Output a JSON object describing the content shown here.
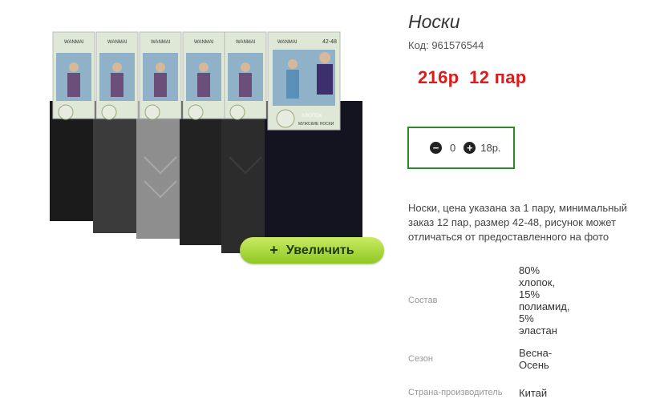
{
  "product": {
    "title": "Носки",
    "code": "Код: 961576544",
    "price_text": "216р  12 пар",
    "zoom_label": "Увеличить",
    "zoom_plus": "+",
    "description": "Носки, цена указана за 1 пару, минимальный заказ 12 пар, размер 42-48, рисунок может отличаться от предоставленного на фото"
  },
  "image": {
    "brand": "WANMAI",
    "size_label": "42-48",
    "cotton_label": "ХЛОПОК",
    "mens_label": "МУЖСКИЕ НОСКИ"
  },
  "quantity": {
    "minus": "−",
    "plus": "+",
    "value": "0",
    "unit_price": "18р."
  },
  "properties": [
    {
      "key": "Состав",
      "value": "80% хлопок, 15% полиамид, 5% эластан"
    },
    {
      "key": "Сезон",
      "value": "Весна-Осень"
    },
    {
      "key": "Страна-производитель",
      "value": "Китай"
    }
  ],
  "colors": {
    "price": "#e0191a",
    "qty_border": "#2c8a26",
    "zoom_button": "#9dd12e"
  }
}
